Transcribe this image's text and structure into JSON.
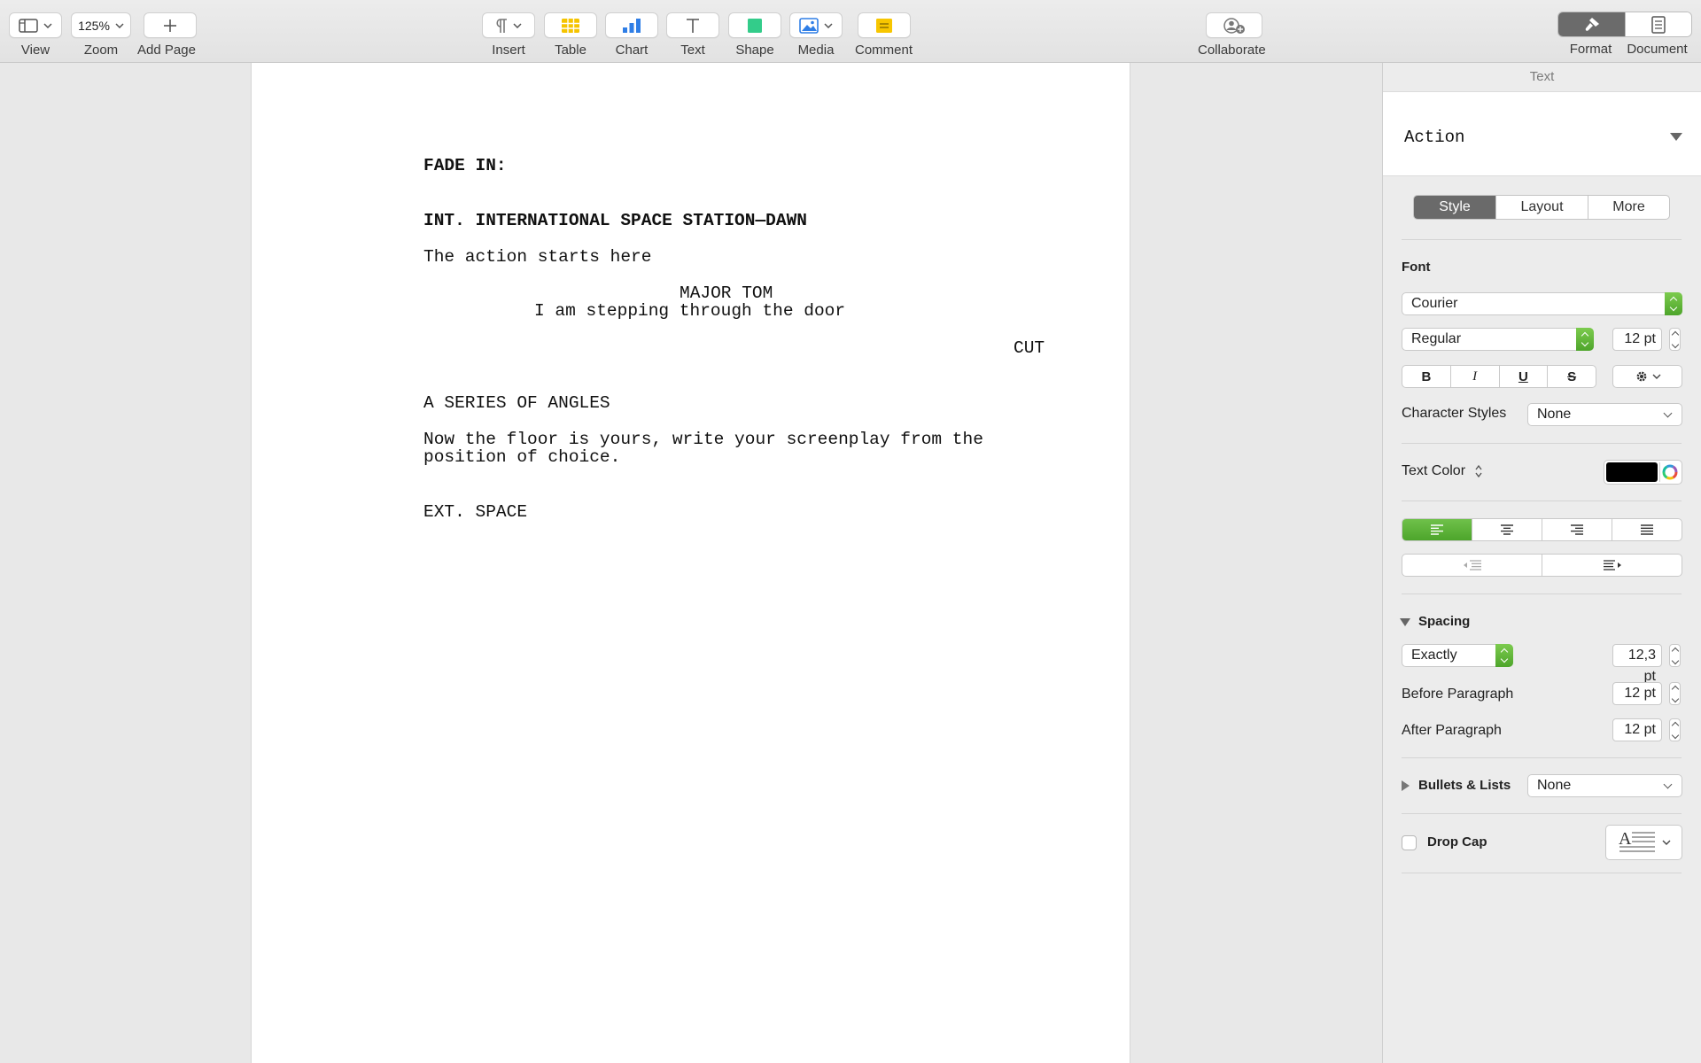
{
  "toolbar": {
    "view": {
      "label": "View",
      "icon": "sidebar-view-icon"
    },
    "zoom": {
      "label": "Zoom",
      "value": "125%"
    },
    "add_page": {
      "label": "Add Page"
    },
    "insert": {
      "label": "Insert",
      "icon": "pilcrow-icon"
    },
    "table": {
      "label": "Table"
    },
    "chart": {
      "label": "Chart"
    },
    "text": {
      "label": "Text"
    },
    "shape": {
      "label": "Shape"
    },
    "media": {
      "label": "Media"
    },
    "comment": {
      "label": "Comment"
    },
    "collaborate": {
      "label": "Collaborate"
    },
    "format": {
      "label": "Format",
      "active": true
    },
    "document": {
      "label": "Document"
    }
  },
  "document": {
    "lines": {
      "fade_in": "FADE IN:",
      "scene1": "INT. INTERNATIONAL SPACE STATION—DAWN",
      "action1": "The action starts here",
      "character": "MAJOR TOM",
      "dialogue": "I am stepping through the door",
      "transition": "CUT",
      "shot": "A SERIES OF ANGLES",
      "action2_line1": "Now the floor is yours, write your screenplay from the",
      "action2_line2": "position of choice.",
      "scene2": "EXT. SPACE"
    }
  },
  "sidebar": {
    "title": "Text",
    "paragraph_style": "Action",
    "tabs": {
      "style": "Style",
      "layout": "Layout",
      "more": "More",
      "active": "Style"
    },
    "font": {
      "label": "Font",
      "family": "Courier",
      "typeface": "Regular",
      "size": "12 pt",
      "bold": "B",
      "italic": "I",
      "underline": "U",
      "strike": "S"
    },
    "character_styles": {
      "label": "Character Styles",
      "value": "None"
    },
    "text_color": {
      "label": "Text Color",
      "color": "#000000"
    },
    "alignment": {
      "active": "left"
    },
    "spacing": {
      "label": "Spacing",
      "mode": "Exactly",
      "value": "12,3 pt",
      "before_label": "Before Paragraph",
      "before_value": "12 pt",
      "after_label": "After Paragraph",
      "after_value": "12 pt"
    },
    "bullets": {
      "label": "Bullets & Lists",
      "value": "None"
    },
    "drop_cap": {
      "label": "Drop Cap",
      "checked": false
    }
  },
  "colors": {
    "accent_green": "#5bb436",
    "table_yellow": "#f5c400",
    "chart_blue": "#2f7ee6",
    "shape_green": "#33cc8a",
    "comment_yellow": "#f7c600"
  }
}
